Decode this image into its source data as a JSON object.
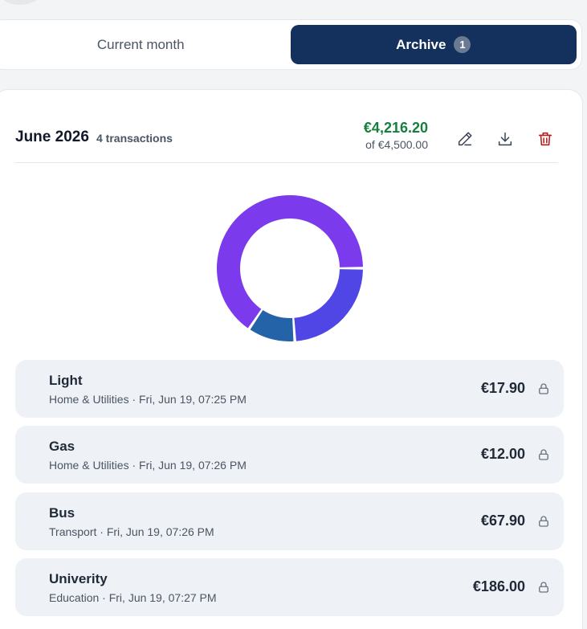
{
  "tabs": {
    "current_label": "Current month",
    "archive_label": "Archive",
    "archive_badge": "1"
  },
  "archive": {
    "month_title": "June 2026",
    "tx_count": "4 transactions",
    "total": "€4,216.20",
    "budget": "of €4,500.00",
    "actions": [
      "edit-icon",
      "download-icon",
      "trash-icon"
    ]
  },
  "chart_data": {
    "type": "pie",
    "variant": "donut",
    "slices": [
      {
        "label": "Education",
        "value": 186.0,
        "color": "#7c3aed"
      },
      {
        "label": "Transport",
        "value": 67.9,
        "color": "#4f46e5"
      },
      {
        "label": "Home & Utilities",
        "value": 29.9,
        "color": "#2563a8"
      }
    ]
  },
  "transactions": [
    {
      "name": "Light",
      "meta": "Home & Utilities · Fri, Jun 19, 07:25 PM",
      "amount": "€17.90"
    },
    {
      "name": "Gas",
      "meta": "Home & Utilities · Fri, Jun 19, 07:26 PM",
      "amount": "€12.00"
    },
    {
      "name": "Bus",
      "meta": "Transport · Fri, Jun 19, 07:26 PM",
      "amount": "€67.90"
    },
    {
      "name": "Univerity",
      "meta": "Education · Fri, Jun 19, 07:27 PM",
      "amount": "€186.00"
    }
  ],
  "colors": {
    "accent": "#14305c",
    "positive": "#15803d",
    "danger": "#b91c1c"
  }
}
